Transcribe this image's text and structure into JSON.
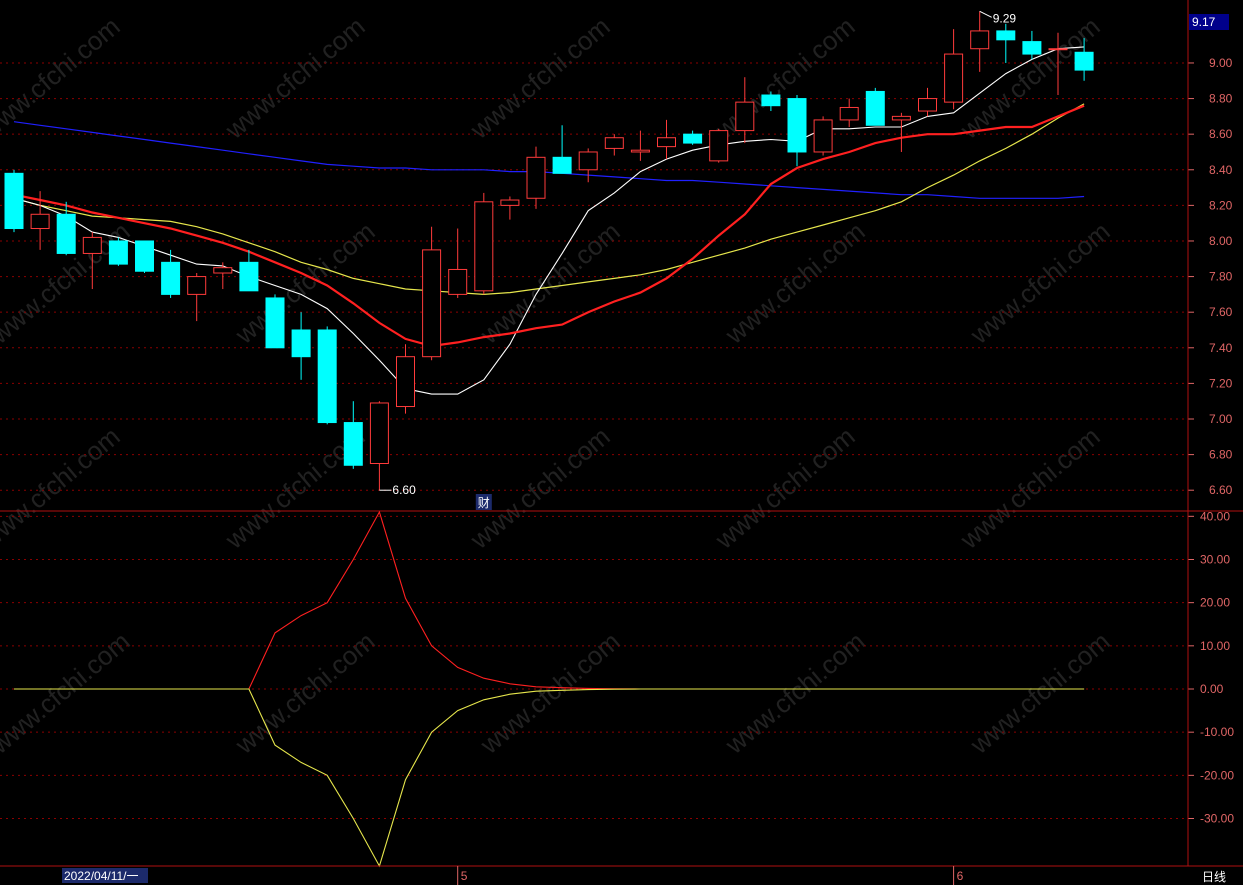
{
  "colors": {
    "background": "#000000",
    "up_candle": "#ff3b3b",
    "down_candle": "#00ffff",
    "ma5": "#ffffff",
    "ma10": "#ff2020",
    "ma20": "#e6e64c",
    "ma60": "#2020ff",
    "grid": "#8b0000",
    "axis_text": "#e06666",
    "osc_upper": "#ff2020",
    "osc_lower": "#e6e64c",
    "price_tag_bg": "#00008b"
  },
  "price_panel": {
    "current_price_label": "9.17",
    "high_annotation": "9.29",
    "low_annotation": "6.60",
    "marker_label": "财",
    "marker_bar_index": 18
  },
  "oscillator_panel": {
    "y_ticks": [
      "40.00",
      "30.00",
      "20.00",
      "10.00",
      "0.00",
      "-10.00",
      "-20.00",
      "-30.00"
    ]
  },
  "bottom_bar": {
    "start_date": "2022/04/11/一",
    "month_labels": [
      {
        "label": "5",
        "bar_index": 17
      },
      {
        "label": "6",
        "bar_index": 36
      }
    ],
    "period_label": "日线"
  },
  "watermark": {
    "text": "www.cfchi.com"
  },
  "chart_data": [
    {
      "type": "candlestick",
      "y_ticks": [
        "9.00",
        "8.80",
        "8.60",
        "8.40",
        "8.20",
        "8.00",
        "7.80",
        "7.60",
        "7.40",
        "7.20",
        "7.00",
        "6.80",
        "6.60"
      ],
      "ylim": [
        6.5,
        9.32
      ],
      "grid": true,
      "candles": [
        {
          "o": 8.38,
          "h": 8.4,
          "l": 8.05,
          "c": 8.07
        },
        {
          "o": 8.07,
          "h": 8.28,
          "l": 7.95,
          "c": 8.15
        },
        {
          "o": 8.15,
          "h": 8.22,
          "l": 7.92,
          "c": 7.93
        },
        {
          "o": 7.93,
          "h": 8.05,
          "l": 7.73,
          "c": 8.02
        },
        {
          "o": 8.0,
          "h": 8.02,
          "l": 7.86,
          "c": 7.87
        },
        {
          "o": 8.0,
          "h": 8.0,
          "l": 7.82,
          "c": 7.83
        },
        {
          "o": 7.88,
          "h": 7.95,
          "l": 7.68,
          "c": 7.7
        },
        {
          "o": 7.7,
          "h": 7.82,
          "l": 7.55,
          "c": 7.8
        },
        {
          "o": 7.82,
          "h": 7.88,
          "l": 7.73,
          "c": 7.85
        },
        {
          "o": 7.88,
          "h": 7.95,
          "l": 7.72,
          "c": 7.72
        },
        {
          "o": 7.68,
          "h": 7.7,
          "l": 7.4,
          "c": 7.4
        },
        {
          "o": 7.5,
          "h": 7.6,
          "l": 7.22,
          "c": 7.35
        },
        {
          "o": 7.5,
          "h": 7.52,
          "l": 6.97,
          "c": 6.98
        },
        {
          "o": 6.98,
          "h": 7.1,
          "l": 6.72,
          "c": 6.74
        },
        {
          "o": 6.75,
          "h": 7.1,
          "l": 6.6,
          "c": 7.09
        },
        {
          "o": 7.07,
          "h": 7.42,
          "l": 7.03,
          "c": 7.35
        },
        {
          "o": 7.35,
          "h": 8.08,
          "l": 7.33,
          "c": 7.95
        },
        {
          "o": 7.7,
          "h": 8.07,
          "l": 7.68,
          "c": 7.84
        },
        {
          "o": 7.72,
          "h": 8.27,
          "l": 7.7,
          "c": 8.22
        },
        {
          "o": 8.2,
          "h": 8.25,
          "l": 8.12,
          "c": 8.23
        },
        {
          "o": 8.24,
          "h": 8.53,
          "l": 8.18,
          "c": 8.47
        },
        {
          "o": 8.47,
          "h": 8.65,
          "l": 8.38,
          "c": 8.38
        },
        {
          "o": 8.4,
          "h": 8.52,
          "l": 8.33,
          "c": 8.5
        },
        {
          "o": 8.52,
          "h": 8.6,
          "l": 8.48,
          "c": 8.58
        },
        {
          "o": 8.5,
          "h": 8.62,
          "l": 8.45,
          "c": 8.51
        },
        {
          "o": 8.53,
          "h": 8.68,
          "l": 8.46,
          "c": 8.58
        },
        {
          "o": 8.6,
          "h": 8.62,
          "l": 8.54,
          "c": 8.55
        },
        {
          "o": 8.45,
          "h": 8.63,
          "l": 8.44,
          "c": 8.62
        },
        {
          "o": 8.62,
          "h": 8.92,
          "l": 8.55,
          "c": 8.78
        },
        {
          "o": 8.82,
          "h": 8.84,
          "l": 8.73,
          "c": 8.76
        },
        {
          "o": 8.8,
          "h": 8.82,
          "l": 8.42,
          "c": 8.5
        },
        {
          "o": 8.5,
          "h": 8.7,
          "l": 8.48,
          "c": 8.68
        },
        {
          "o": 8.68,
          "h": 8.8,
          "l": 8.64,
          "c": 8.75
        },
        {
          "o": 8.84,
          "h": 8.86,
          "l": 8.65,
          "c": 8.65
        },
        {
          "o": 8.68,
          "h": 8.72,
          "l": 8.5,
          "c": 8.7
        },
        {
          "o": 8.73,
          "h": 8.86,
          "l": 8.7,
          "c": 8.8
        },
        {
          "o": 8.78,
          "h": 9.19,
          "l": 8.74,
          "c": 9.05
        },
        {
          "o": 9.08,
          "h": 9.29,
          "l": 8.95,
          "c": 9.18
        },
        {
          "o": 9.18,
          "h": 9.22,
          "l": 9.0,
          "c": 9.13
        },
        {
          "o": 9.12,
          "h": 9.18,
          "l": 9.02,
          "c": 9.05
        },
        {
          "o": 9.08,
          "h": 9.17,
          "l": 8.82,
          "c": 9.08
        },
        {
          "o": 9.06,
          "h": 9.14,
          "l": 8.9,
          "c": 8.96
        }
      ],
      "ma5": [
        8.24,
        8.2,
        8.14,
        8.05,
        8.02,
        7.97,
        7.92,
        7.87,
        7.86,
        7.8,
        7.75,
        7.7,
        7.62,
        7.48,
        7.33,
        7.17,
        7.14,
        7.14,
        7.22,
        7.42,
        7.7,
        7.93,
        8.17,
        8.27,
        8.39,
        8.46,
        8.51,
        8.54,
        8.56,
        8.57,
        8.56,
        8.63,
        8.63,
        8.64,
        8.64,
        8.7,
        8.72,
        8.83,
        8.94,
        9.02,
        9.08,
        9.09
      ],
      "ma10": [
        8.26,
        8.23,
        8.2,
        8.16,
        8.13,
        8.1,
        8.07,
        8.03,
        7.99,
        7.94,
        7.88,
        7.82,
        7.75,
        7.65,
        7.54,
        7.45,
        7.41,
        7.43,
        7.46,
        7.48,
        7.51,
        7.53,
        7.6,
        7.66,
        7.71,
        7.79,
        7.9,
        8.03,
        8.15,
        8.32,
        8.41,
        8.46,
        8.5,
        8.55,
        8.58,
        8.6,
        8.6,
        8.62,
        8.64,
        8.64,
        8.7,
        8.76
      ],
      "ma20": [
        8.24,
        8.2,
        8.17,
        8.14,
        8.13,
        8.12,
        8.11,
        8.08,
        8.04,
        7.99,
        7.94,
        7.88,
        7.84,
        7.79,
        7.76,
        7.73,
        7.72,
        7.71,
        7.7,
        7.71,
        7.73,
        7.75,
        7.77,
        7.79,
        7.81,
        7.84,
        7.88,
        7.92,
        7.96,
        8.01,
        8.05,
        8.09,
        8.13,
        8.17,
        8.22,
        8.3,
        8.37,
        8.45,
        8.52,
        8.6,
        8.69,
        8.77
      ],
      "ma60": [
        8.67,
        8.65,
        8.63,
        8.61,
        8.59,
        8.57,
        8.55,
        8.53,
        8.51,
        8.49,
        8.47,
        8.45,
        8.43,
        8.42,
        8.41,
        8.41,
        8.4,
        8.4,
        8.4,
        8.39,
        8.39,
        8.38,
        8.37,
        8.36,
        8.35,
        8.34,
        8.34,
        8.33,
        8.32,
        8.31,
        8.3,
        8.29,
        8.28,
        8.27,
        8.26,
        8.26,
        8.25,
        8.24,
        8.24,
        8.24,
        8.24,
        8.25
      ]
    },
    {
      "type": "line",
      "ylim": [
        -41,
        41
      ],
      "series": [
        {
          "values": [
            0,
            0,
            0,
            0,
            0,
            0,
            0,
            0,
            0,
            0,
            13,
            17,
            20,
            30,
            41,
            21,
            10,
            5,
            2.5,
            1.2,
            0.5,
            0.3,
            0.15,
            0.05,
            0,
            0,
            0,
            0,
            0,
            0,
            0,
            0,
            0,
            0,
            0,
            0,
            0,
            0,
            0,
            0,
            0,
            0
          ]
        },
        {
          "values": [
            0,
            0,
            0,
            0,
            0,
            0,
            0,
            0,
            0,
            0,
            -13,
            -17,
            -20,
            -30,
            -41,
            -21,
            -10,
            -5,
            -2.5,
            -1.2,
            -0.5,
            -0.3,
            -0.15,
            -0.05,
            0,
            0,
            0,
            0,
            0,
            0,
            0,
            0,
            0,
            0,
            0,
            0,
            0,
            0,
            0,
            0,
            0,
            0
          ]
        }
      ]
    }
  ]
}
